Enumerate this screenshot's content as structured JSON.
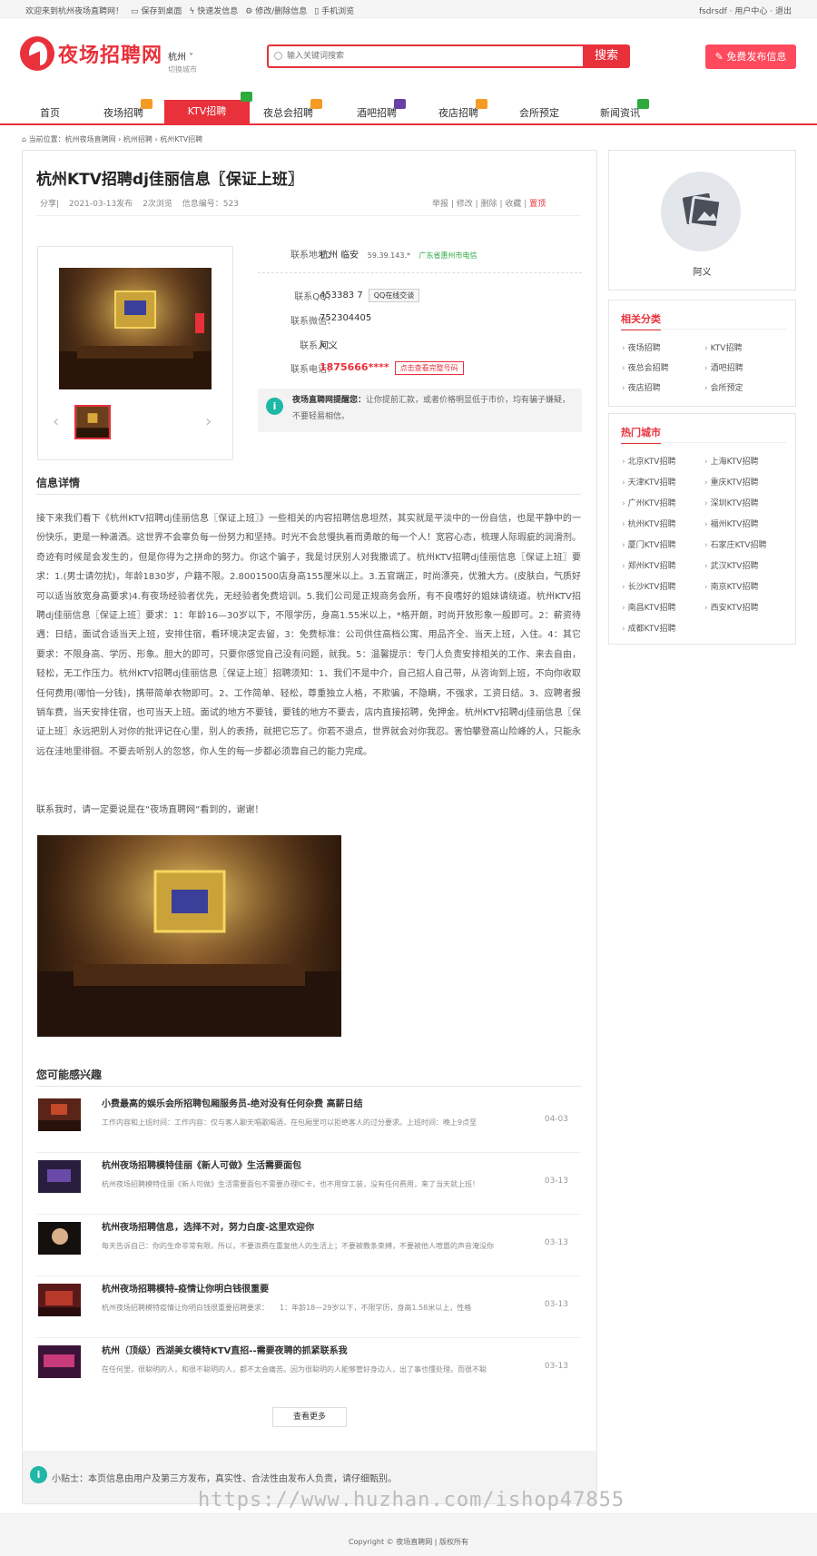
{
  "topbar": {
    "welcome": "欢迎来到杭州夜场直聘网！",
    "save_desktop": "保存到桌面",
    "quick_post": "快速发信息",
    "edit_delete": "修改/删除信息",
    "mobile": "手机浏览",
    "user": "fsdrsdf",
    "user_center": "用户中心",
    "logout": "退出"
  },
  "header": {
    "logo_text": "夜场招聘网",
    "city": "杭州",
    "city_switch": "切换城市",
    "search_placeholder": "输入关键词搜索",
    "search_button": "搜索",
    "publish_button": "免费发布信息"
  },
  "nav": {
    "items": [
      {
        "label": "首页",
        "badge": ""
      },
      {
        "label": "夜场招聘",
        "badge": "#f59b23"
      },
      {
        "label": "KTV招聘",
        "badge": "#2eaa3f",
        "active": true
      },
      {
        "label": "夜总会招聘",
        "badge": "#f59b23"
      },
      {
        "label": "酒吧招聘",
        "badge": "#6a3ea8"
      },
      {
        "label": "夜店招聘",
        "badge": "#f59b23"
      },
      {
        "label": "会所预定",
        "badge": ""
      },
      {
        "label": "新闻资讯",
        "badge": "#2eaa3f"
      }
    ]
  },
  "breadcrumb": {
    "prefix": "当前位置：",
    "path": "杭州夜场直聘网 › 杭州招聘 › 杭州KTV招聘"
  },
  "post": {
    "title": "杭州KTV招聘dj佳丽信息〖保证上班〗",
    "share": "分享",
    "date": "2021-03-13发布",
    "views": "2次浏览",
    "id_label": "信息编号：523",
    "actions": [
      "举报",
      "修改",
      "删除",
      "收藏",
      "置顶"
    ]
  },
  "contact": {
    "address_label": "联系地址：",
    "address": "杭州 临安",
    "ip": "59.39.143.*",
    "ip_location": "广东省惠州市电信",
    "qq_label": "联系QQ：",
    "qq": "453383 7",
    "qq_button": "QQ在线交谈",
    "wechat_label": "联系微信：",
    "wechat": "752304405",
    "person_label": "联系人：",
    "person": "阿义",
    "phone_label": "联系电话：",
    "phone": "1875666****",
    "phone_button": "点击查看完整号码",
    "notice_title": "夜场直聘网提醒您：",
    "notice_text": "让你提前汇款，或者价格明显低于市价，均有骗子嫌疑，不要轻易相信。"
  },
  "details": {
    "heading": "信息详情",
    "text": "接下来我们看下《杭州KTV招聘dj佳丽信息〖保证上班〗》一些相关的内容招聘信息坦然，其实就是平淡中的一份自信，也是平静中的一份快乐，更是一种潇洒。这世界不会辜负每一份努力和坚持。时光不会怠慢执着而勇敢的每一个人！宽容心态，梳理人际瑕疵的润滑剂。奇迹有时候是会发生的，但是你得为之拼命的努力。你这个骗子，我是讨厌别人对我撒谎了。杭州KTV招聘dj佳丽信息〖保证上班〗要求：1.(男士请勿扰)，年龄1830岁，户籍不限。2.8001500店身高155厘米以上。3.五官端正，时尚漂亮，优雅大方。(皮肤白，气质好可以适当放宽身高要求)4.有夜场经验者优先，无经验者免费培训。5.我们公司是正规商务会所，有不良嗜好的姐妹请绕道。杭州KTV招聘dj佳丽信息〖保证上班〗要求：1：年龄16—30岁以下，不限学历，身高1.55米以上，*格开朗，时尚开放形象一般即可。2：薪资待遇：日结，面试合适当天上班，安排住宿，看环境决定去留，3：免费标准：公司供住高档公寓、用品齐全、当天上班，入住。4：其它要求：不限身高、学历、形象。胆大的即可，只要你感觉自己没有问题，就我。5：温馨提示：专门人负责安排相关的工作、来去自由，轻松，无工作压力。杭州KTV招聘dj佳丽信息〖保证上班〗招聘须知：1、我们不是中介，自己招人自己带，从咨询到上班，不向你收取任何费用(哪怕一分钱)，携带简单衣物即可。2、工作简单、轻松，尊重独立人格，不欺骗，不隐瞒，不强求，工资日结。3、应聘者报销车费，当天安排住宿，也可当天上班。面试的地方不要钱，要钱的地方不要去，店内直接招聘，免押金。杭州KTV招聘dj佳丽信息〖保证上班〗永远把别人对你的批评记在心里，别人的表扬，就把它忘了。你若不退点，世界就会对你我忍。害怕攀登高山险峰的人，只能永远在洼地里徘徊。不要去听别人的忽悠，你人生的每一步都必须靠自己的能力完成。",
    "contact_line": "联系我时，请一定要说是在“夜场直聘网”看到的，谢谢！"
  },
  "interest": {
    "heading": "您可能感兴趣",
    "items": [
      {
        "title": "小费最高的娱乐会所招聘包厢服务员-绝对没有任何杂费 高薪日结",
        "desc": "工作内容和上班时间：工作内容：仅与客人聊天唱歌喝酒，在包厢里可以拒绝客人的过分要求。上班时间：晚上9点至",
        "date": "04-03",
        "color": "#8a3b2a"
      },
      {
        "title": "杭州夜场招聘模特佳丽《新人可做》生活需要面包",
        "desc": "杭州夜场招聘模特佳丽《新人可做》生活需要面包不需要办理IC卡，也不用穿工装，没有任何费用，来了当天就上班！",
        "date": "03-13",
        "color": "#4a3b6a"
      },
      {
        "title": "杭州夜场招聘信息，选择不对，努力白废-这里欢迎你",
        "desc": "每天告诉自己：你的生命非常有限，所以，不要浪费在重复他人的生活上；不要被教条束缚，不要被他人喧嚣的声音淹没你",
        "date": "03-13",
        "color": "#2a2320"
      },
      {
        "title": "杭州夜场招聘模特-疫情让你明白钱很重要",
        "desc": "杭州夜场招聘模特疫情让你明白钱很重要招聘要求：　　1：年龄18—29岁以下，不限学历，身高1.58米以上，性格",
        "date": "03-13",
        "color": "#7a2a2a"
      },
      {
        "title": "杭州（顶级）西湖美女模特KTV直招--需要夜聘的抓紧联系我",
        "desc": "在任何里，很聪明的人，和很不聪明的人，都不太会痛苦。因为很聪明的人能够管好身边人，出了事也懂处理。而很不聪",
        "date": "03-13",
        "color": "#6a2a5a"
      }
    ],
    "more": "查看更多"
  },
  "tip": {
    "text": "小贴士：本页信息由用户及第三方发布，真实性、合法性由发布人负责，请仔细甄别。"
  },
  "sidebar": {
    "username": "阿义",
    "related_title": "相关分类",
    "related": [
      "夜场招聘",
      "KTV招聘",
      "夜总会招聘",
      "酒吧招聘",
      "夜店招聘",
      "会所预定"
    ],
    "hot_title": "热门城市",
    "cities": [
      "北京KTV招聘",
      "上海KTV招聘",
      "天津KTV招聘",
      "重庆KTV招聘",
      "广州KTV招聘",
      "深圳KTV招聘",
      "杭州KTV招聘",
      "福州KTV招聘",
      "厦门KTV招聘",
      "石家庄KTV招聘",
      "郑州KTV招聘",
      "武汉KTV招聘",
      "长沙KTV招聘",
      "南京KTV招聘",
      "南昌KTV招聘",
      "西安KTV招聘",
      "成都KTV招聘"
    ]
  },
  "footer": {
    "watermark": "https://www.huzhan.com/ishop47855",
    "copyright": "Copyright © 夜场直聘网 | 版权所有"
  }
}
